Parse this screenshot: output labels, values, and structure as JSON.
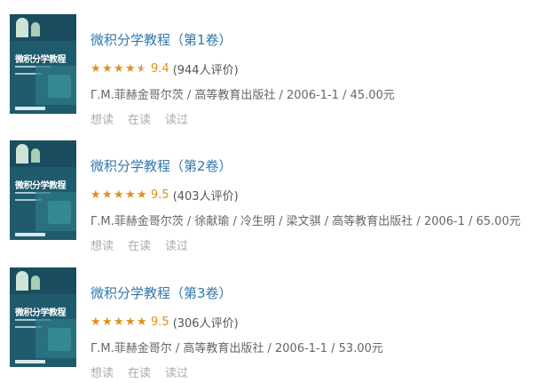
{
  "books": [
    {
      "title": "微积分学教程（第1卷）",
      "stars": [
        1,
        1,
        1,
        1,
        0.5
      ],
      "score": "9.4",
      "count": "(944人评价)",
      "meta": "Γ.Μ.菲赫金哥尔茨 / 高等教育出版社 / 2006-1-1 / 45.00元",
      "actions": [
        "想读",
        "在读",
        "读过"
      ]
    },
    {
      "title": "微积分学教程（第2卷）",
      "stars": [
        1,
        1,
        1,
        1,
        1
      ],
      "score": "9.5",
      "count": "(403人评价)",
      "meta": "Γ.Μ.菲赫金哥尔茨 / 徐献瑜 / 冷生明 / 梁文骐 / 高等教育出版社 / 2006-1 / 65.00元",
      "actions": [
        "想读",
        "在读",
        "读过"
      ]
    },
    {
      "title": "微积分学教程（第3卷）",
      "stars": [
        1,
        1,
        1,
        1,
        1
      ],
      "score": "9.5",
      "count": "(306人评价)",
      "meta": "Γ.Μ.菲赫金哥尔 / 高等教育出版社 / 2006-1-1 / 53.00元",
      "actions": [
        "想读",
        "在读",
        "读过"
      ]
    }
  ],
  "cover": {
    "title": "微积分学教程",
    "color": "#1f5a6d"
  },
  "colors": {
    "link": "#3377aa",
    "star": "#e09015",
    "meta": "#666666",
    "action": "#aaaaaa"
  }
}
